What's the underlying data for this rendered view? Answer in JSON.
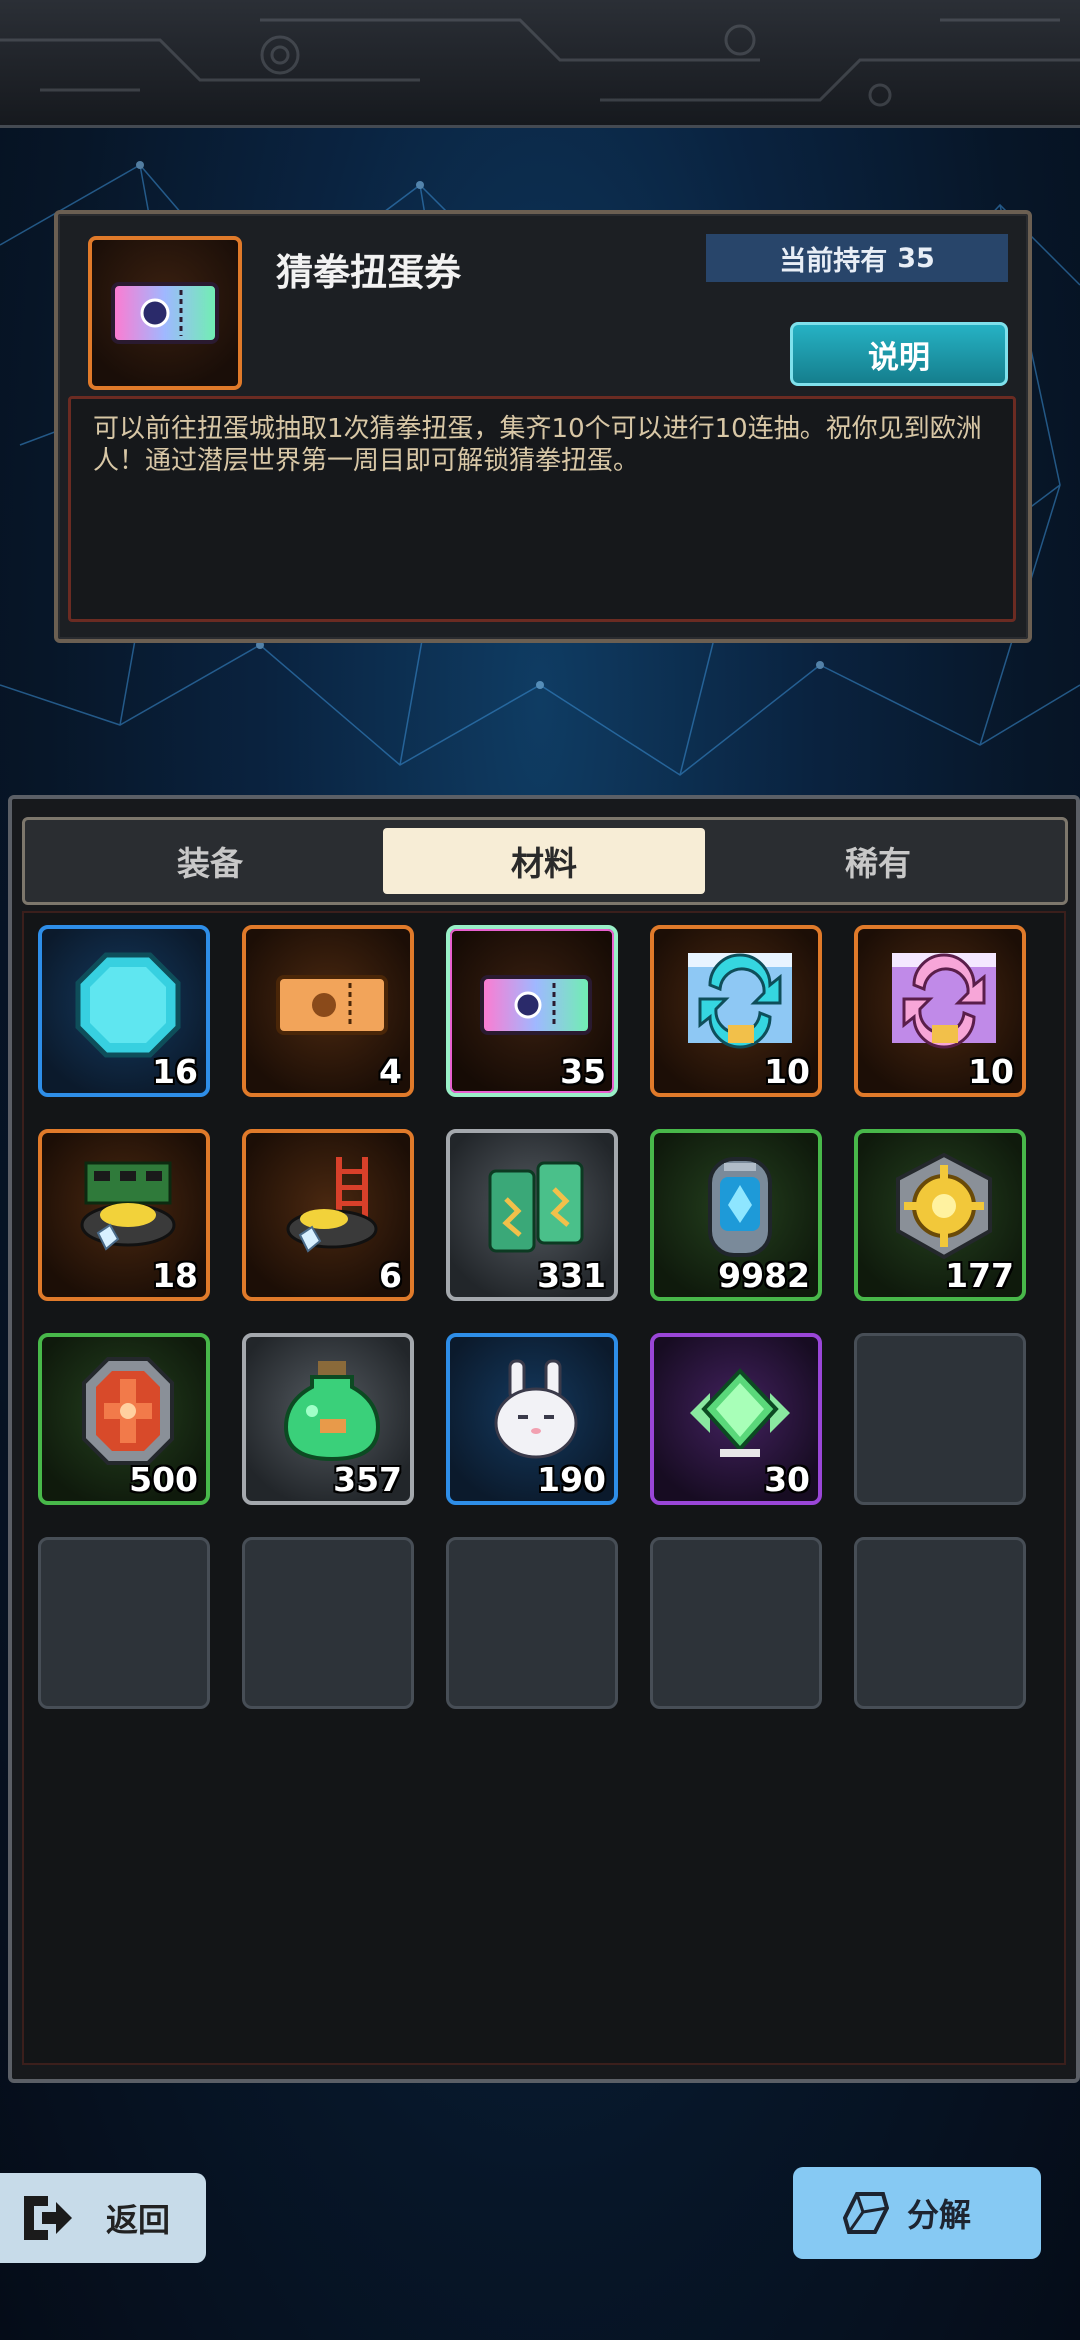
{
  "item_info": {
    "name": "猜拳扭蛋券",
    "hold_label": "当前持有",
    "hold_count": "35",
    "explain_button": "说明",
    "description": "可以前往扭蛋城抽取1次猜拳扭蛋，集齐10个可以进行10连抽。祝你见到欧洲人！通过潜层世界第一周目即可解锁猜拳扭蛋。",
    "icon": "rainbow-ticket-icon"
  },
  "tabs": [
    {
      "label": "装备",
      "active": false
    },
    {
      "label": "材料",
      "active": true
    },
    {
      "label": "稀有",
      "active": false
    }
  ],
  "inventory": [
    {
      "icon": "cyan-gem-icon",
      "count": "16",
      "rarity": "blue"
    },
    {
      "icon": "orange-ticket-icon",
      "count": "4",
      "rarity": "orange"
    },
    {
      "icon": "rainbow-ticket-icon",
      "count": "35",
      "rarity": "rainbow",
      "selected": true
    },
    {
      "icon": "blue-cycle-ticket-icon",
      "count": "10",
      "rarity": "orange"
    },
    {
      "icon": "pink-cycle-ticket-icon",
      "count": "10",
      "rarity": "orange"
    },
    {
      "icon": "circuit-board-pot-icon",
      "count": "18",
      "rarity": "orange"
    },
    {
      "icon": "ladder-pot-icon",
      "count": "6",
      "rarity": "orange"
    },
    {
      "icon": "battery-pack-icon",
      "count": "331",
      "rarity": "gray"
    },
    {
      "icon": "blue-crystal-capsule-icon",
      "count": "9982",
      "rarity": "green"
    },
    {
      "icon": "gold-gear-core-icon",
      "count": "177",
      "rarity": "green"
    },
    {
      "icon": "red-reactor-core-icon",
      "count": "500",
      "rarity": "green"
    },
    {
      "icon": "green-potion-jar-icon",
      "count": "357",
      "rarity": "gray"
    },
    {
      "icon": "white-rabbit-icon",
      "count": "190",
      "rarity": "blue"
    },
    {
      "icon": "green-diamond-emblem-icon",
      "count": "30",
      "rarity": "purple"
    }
  ],
  "bottom": {
    "back_label": "返回",
    "dismantle_label": "分解"
  },
  "colors": {
    "rarity_blue": "#2e8ee8",
    "rarity_orange": "#e07a2a",
    "rarity_green": "#48b84a",
    "rarity_gray": "#a4a8ad",
    "rarity_purple": "#9a46d8",
    "explain_button": "#26b2c4",
    "dismantle_button": "#86c9f3",
    "back_button": "#c7dbe9"
  }
}
